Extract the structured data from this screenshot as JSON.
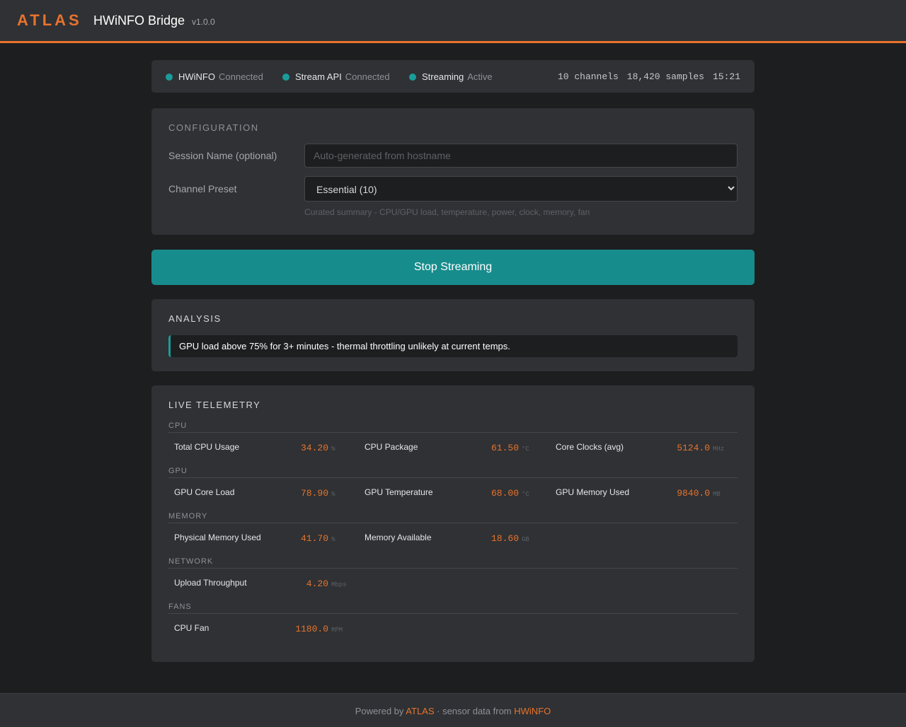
{
  "header": {
    "brand": "ATLAS",
    "title": "HWiNFO Bridge",
    "version": "v1.0.0"
  },
  "status": {
    "items": [
      {
        "name": "HWiNFO",
        "value": "Connected"
      },
      {
        "name": "Stream API",
        "value": "Connected"
      },
      {
        "name": "Streaming",
        "value": "Active"
      }
    ],
    "channels": "10 channels",
    "samples": "18,420 samples",
    "time": "15:21"
  },
  "config": {
    "title": "CONFIGURATION",
    "session_label": "Session Name (optional)",
    "session_value": "",
    "session_placeholder": "Auto-generated from hostname",
    "preset_label": "Channel Preset",
    "preset_value": "Essential (10)",
    "preset_hint": "Curated summary - CPU/GPU load, temperature, power, clock, memory, fan"
  },
  "actions": {
    "stop_label": "Stop Streaming"
  },
  "analysis": {
    "title": "ANALYSIS",
    "insight": "GPU load above 75% for 3+ minutes - thermal throttling unlikely at current temps."
  },
  "telemetry": {
    "title": "LIVE TELEMETRY",
    "groups": [
      {
        "name": "CPU",
        "metrics": [
          {
            "label": "Total CPU Usage",
            "value": "34.20",
            "unit": "%"
          },
          {
            "label": "CPU Package",
            "value": "61.50",
            "unit": "°C"
          },
          {
            "label": "Core Clocks (avg)",
            "value": "5124.0",
            "unit": "MHz"
          }
        ]
      },
      {
        "name": "GPU",
        "metrics": [
          {
            "label": "GPU Core Load",
            "value": "78.90",
            "unit": "%"
          },
          {
            "label": "GPU Temperature",
            "value": "68.00",
            "unit": "°C"
          },
          {
            "label": "GPU Memory Used",
            "value": "9840.0",
            "unit": "MB"
          }
        ]
      },
      {
        "name": "MEMORY",
        "metrics": [
          {
            "label": "Physical Memory Used",
            "value": "41.70",
            "unit": "%"
          },
          {
            "label": "Memory Available",
            "value": "18.60",
            "unit": "GB"
          }
        ]
      },
      {
        "name": "NETWORK",
        "metrics": [
          {
            "label": "Upload Throughput",
            "value": "4.20",
            "unit": "Mbps"
          }
        ]
      },
      {
        "name": "FANS",
        "metrics": [
          {
            "label": "CPU Fan",
            "value": "1180.0",
            "unit": "RPM"
          }
        ]
      }
    ]
  },
  "footer": {
    "prefix": "Powered by",
    "atlas": "ATLAS",
    "middle": "· sensor data from",
    "hwinfo": "HWiNFO"
  },
  "colors": {
    "accent": "#e8732c",
    "status_ok": "#1a9d9a",
    "stop_button": "#178c8c"
  }
}
